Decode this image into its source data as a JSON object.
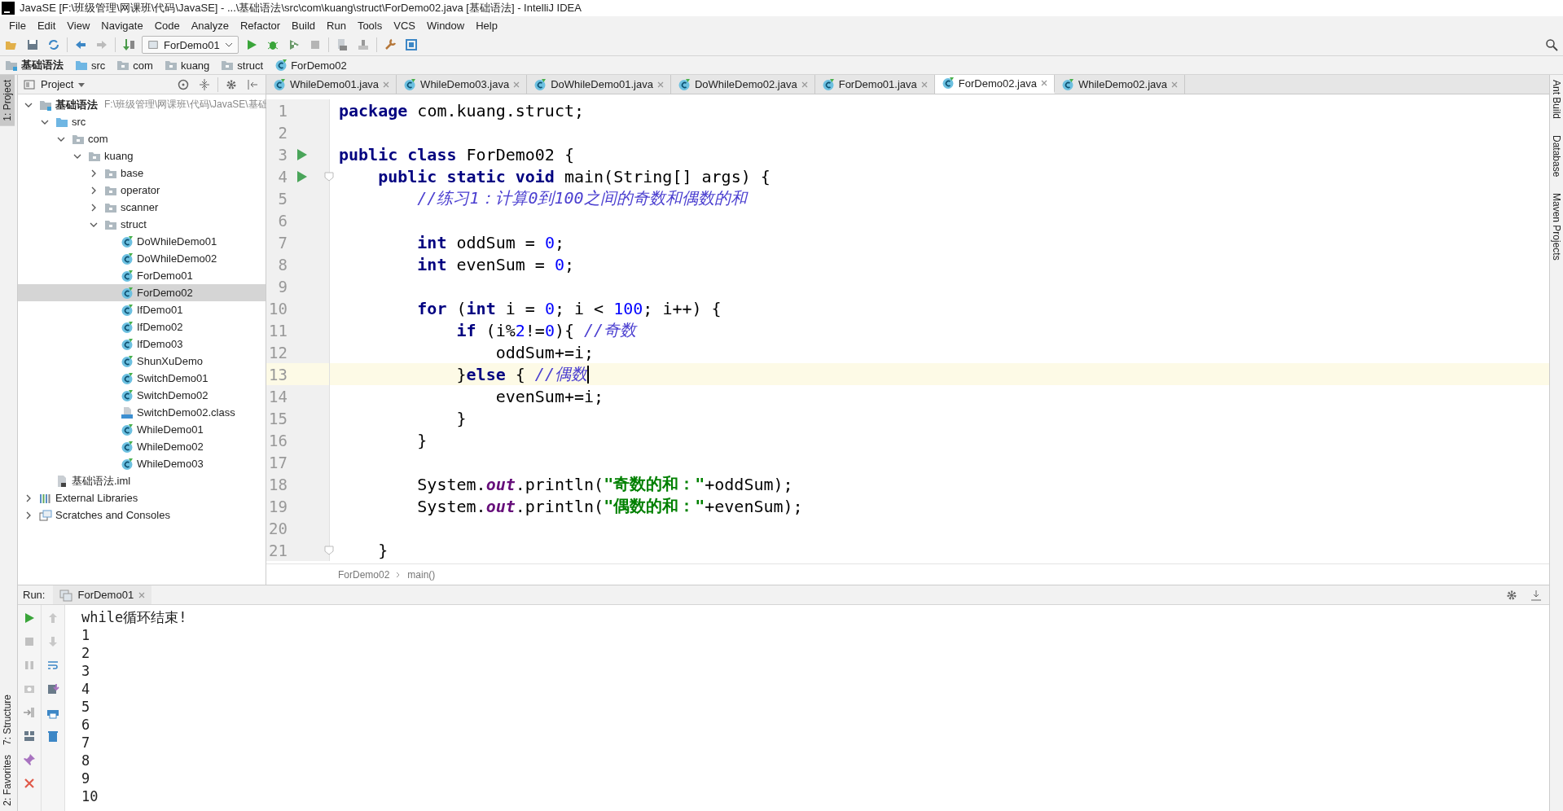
{
  "window": {
    "title": "JavaSE [F:\\班级管理\\网课班\\代码\\JavaSE] - ...\\基础语法\\src\\com\\kuang\\struct\\ForDemo02.java [基础语法] - IntelliJ IDEA"
  },
  "menu": [
    "File",
    "Edit",
    "View",
    "Navigate",
    "Code",
    "Analyze",
    "Refactor",
    "Build",
    "Run",
    "Tools",
    "VCS",
    "Window",
    "Help"
  ],
  "toolbar": {
    "run_config": "ForDemo01"
  },
  "nav_bar": [
    {
      "label": "基础语法",
      "kind": "module"
    },
    {
      "label": "src",
      "kind": "source"
    },
    {
      "label": "com",
      "kind": "package"
    },
    {
      "label": "kuang",
      "kind": "package"
    },
    {
      "label": "struct",
      "kind": "package"
    },
    {
      "label": "ForDemo02",
      "kind": "class"
    }
  ],
  "left_stripe": {
    "top": [
      {
        "label": "1: Project",
        "selected": true
      }
    ],
    "bottom": [
      {
        "label": "7: Structure",
        "selected": false
      },
      {
        "label": "2: Favorites",
        "selected": false
      }
    ]
  },
  "right_stripe": [
    "Ant Build",
    "Database",
    "Maven Projects"
  ],
  "project_panel": {
    "title": "Project",
    "tree": [
      {
        "label": "基础语法",
        "kind": "module",
        "hint": "F:\\班级管理\\网课班\\代码\\JavaSE\\基础",
        "expanded": true,
        "selected": false,
        "children": [
          {
            "label": "src",
            "kind": "source",
            "expanded": true,
            "selected": false,
            "children": [
              {
                "label": "com",
                "kind": "package",
                "expanded": true,
                "selected": false,
                "children": [
                  {
                    "label": "kuang",
                    "kind": "package",
                    "expanded": true,
                    "selected": false,
                    "children": [
                      {
                        "label": "base",
                        "kind": "package",
                        "expanded": false,
                        "selected": false
                      },
                      {
                        "label": "operator",
                        "kind": "package",
                        "expanded": false,
                        "selected": false
                      },
                      {
                        "label": "scanner",
                        "kind": "package",
                        "expanded": false,
                        "selected": false
                      },
                      {
                        "label": "struct",
                        "kind": "package",
                        "expanded": true,
                        "selected": false,
                        "children": [
                          {
                            "label": "DoWhileDemo01",
                            "kind": "class",
                            "selected": false
                          },
                          {
                            "label": "DoWhileDemo02",
                            "kind": "class",
                            "selected": false
                          },
                          {
                            "label": "ForDemo01",
                            "kind": "class",
                            "selected": false
                          },
                          {
                            "label": "ForDemo02",
                            "kind": "class",
                            "selected": true
                          },
                          {
                            "label": "IfDemo01",
                            "kind": "class",
                            "selected": false
                          },
                          {
                            "label": "IfDemo02",
                            "kind": "class",
                            "selected": false
                          },
                          {
                            "label": "IfDemo03",
                            "kind": "class",
                            "selected": false
                          },
                          {
                            "label": "ShunXuDemo",
                            "kind": "class",
                            "selected": false
                          },
                          {
                            "label": "SwitchDemo01",
                            "kind": "class",
                            "selected": false
                          },
                          {
                            "label": "SwitchDemo02",
                            "kind": "class",
                            "selected": false
                          },
                          {
                            "label": "SwitchDemo02.class",
                            "kind": "classfile",
                            "selected": false
                          },
                          {
                            "label": "WhileDemo01",
                            "kind": "class",
                            "selected": false
                          },
                          {
                            "label": "WhileDemo02",
                            "kind": "class",
                            "selected": false
                          },
                          {
                            "label": "WhileDemo03",
                            "kind": "class",
                            "selected": false
                          }
                        ]
                      }
                    ]
                  }
                ]
              }
            ]
          },
          {
            "label": "基础语法.iml",
            "kind": "iml",
            "selected": false
          }
        ]
      },
      {
        "label": "External Libraries",
        "kind": "library",
        "expanded": false,
        "selected": false
      },
      {
        "label": "Scratches and Consoles",
        "kind": "scratches",
        "expanded": false,
        "selected": false
      }
    ]
  },
  "tabs": [
    {
      "label": "WhileDemo01.java",
      "selected": false
    },
    {
      "label": "WhileDemo03.java",
      "selected": false
    },
    {
      "label": "DoWhileDemo01.java",
      "selected": false
    },
    {
      "label": "DoWhileDemo02.java",
      "selected": false
    },
    {
      "label": "ForDemo01.java",
      "selected": false
    },
    {
      "label": "ForDemo02.java",
      "selected": true
    },
    {
      "label": "WhileDemo02.java",
      "selected": false
    }
  ],
  "editor": {
    "lines": [
      {
        "number": "1",
        "current": false,
        "run_marker": false,
        "fold_marker": false,
        "tokens": [
          {
            "kind": "keyword",
            "text": "package"
          },
          {
            "kind": "plain",
            "text": " com.kuang.struct;"
          }
        ]
      },
      {
        "number": "2",
        "current": false,
        "run_marker": false,
        "fold_marker": false
      },
      {
        "number": "3",
        "current": false,
        "run_marker": true,
        "fold_marker": false,
        "tokens": [
          {
            "kind": "keyword",
            "text": "public class"
          },
          {
            "kind": "plain",
            "text": " ForDemo02 {"
          }
        ]
      },
      {
        "number": "4",
        "current": false,
        "run_marker": true,
        "fold_marker": true,
        "tokens": [
          {
            "kind": "keyword",
            "text": "    public static void"
          },
          {
            "kind": "plain",
            "text": " main(String[] args) {"
          }
        ]
      },
      {
        "number": "5",
        "current": false,
        "run_marker": false,
        "fold_marker": false,
        "tokens": [
          {
            "kind": "comment",
            "text": "        //练习1：计算0到100之间的奇数和偶数的和"
          }
        ]
      },
      {
        "number": "6",
        "current": false,
        "run_marker": false,
        "fold_marker": false
      },
      {
        "number": "7",
        "current": false,
        "run_marker": false,
        "fold_marker": false,
        "tokens": [
          {
            "kind": "keyword",
            "text": "        int"
          },
          {
            "kind": "plain",
            "text": " oddSum = "
          },
          {
            "kind": "number",
            "text": "0"
          },
          {
            "kind": "plain",
            "text": ";"
          }
        ]
      },
      {
        "number": "8",
        "current": false,
        "run_marker": false,
        "fold_marker": false,
        "tokens": [
          {
            "kind": "keyword",
            "text": "        int"
          },
          {
            "kind": "plain",
            "text": " evenSum = "
          },
          {
            "kind": "number",
            "text": "0"
          },
          {
            "kind": "plain",
            "text": ";"
          }
        ]
      },
      {
        "number": "9",
        "current": false,
        "run_marker": false,
        "fold_marker": false
      },
      {
        "number": "10",
        "current": false,
        "run_marker": false,
        "fold_marker": false,
        "tokens": [
          {
            "kind": "keyword",
            "text": "        for"
          },
          {
            "kind": "plain",
            "text": " ("
          },
          {
            "kind": "keyword",
            "text": "int"
          },
          {
            "kind": "plain",
            "text": " i = "
          },
          {
            "kind": "number",
            "text": "0"
          },
          {
            "kind": "plain",
            "text": "; i < "
          },
          {
            "kind": "number",
            "text": "100"
          },
          {
            "kind": "plain",
            "text": "; i++) {"
          }
        ]
      },
      {
        "number": "11",
        "current": false,
        "run_marker": false,
        "fold_marker": false,
        "tokens": [
          {
            "kind": "keyword",
            "text": "            if"
          },
          {
            "kind": "plain",
            "text": " (i%"
          },
          {
            "kind": "number",
            "text": "2"
          },
          {
            "kind": "plain",
            "text": "!="
          },
          {
            "kind": "number",
            "text": "0"
          },
          {
            "kind": "plain",
            "text": "){ "
          },
          {
            "kind": "comment",
            "text": "//奇数"
          }
        ]
      },
      {
        "number": "12",
        "current": false,
        "run_marker": false,
        "fold_marker": false,
        "tokens": [
          {
            "kind": "plain",
            "text": "                oddSum+=i;"
          }
        ]
      },
      {
        "number": "13",
        "current": true,
        "run_marker": false,
        "fold_marker": false,
        "tokens": [
          {
            "kind": "plain",
            "text": "            }"
          },
          {
            "kind": "keyword",
            "text": "else"
          },
          {
            "kind": "plain",
            "text": " { "
          },
          {
            "kind": "comment",
            "text": "//偶数"
          }
        ]
      },
      {
        "number": "14",
        "current": false,
        "run_marker": false,
        "fold_marker": false,
        "tokens": [
          {
            "kind": "plain",
            "text": "                evenSum+=i;"
          }
        ]
      },
      {
        "number": "15",
        "current": false,
        "run_marker": false,
        "fold_marker": false,
        "tokens": [
          {
            "kind": "plain",
            "text": "            }"
          }
        ]
      },
      {
        "number": "16",
        "current": false,
        "run_marker": false,
        "fold_marker": false,
        "tokens": [
          {
            "kind": "plain",
            "text": "        }"
          }
        ]
      },
      {
        "number": "17",
        "current": false,
        "run_marker": false,
        "fold_marker": false
      },
      {
        "number": "18",
        "current": false,
        "run_marker": false,
        "fold_marker": false,
        "tokens": [
          {
            "kind": "plain",
            "text": "        System."
          },
          {
            "kind": "field",
            "text": "out"
          },
          {
            "kind": "plain",
            "text": ".println("
          },
          {
            "kind": "string",
            "text": "\"奇数的和：\""
          },
          {
            "kind": "plain",
            "text": "+oddSum);"
          }
        ]
      },
      {
        "number": "19",
        "current": false,
        "run_marker": false,
        "fold_marker": false,
        "tokens": [
          {
            "kind": "plain",
            "text": "        System."
          },
          {
            "kind": "field",
            "text": "out"
          },
          {
            "kind": "plain",
            "text": ".println("
          },
          {
            "kind": "string",
            "text": "\"偶数的和：\""
          },
          {
            "kind": "plain",
            "text": "+evenSum);"
          }
        ]
      },
      {
        "number": "20",
        "current": false,
        "run_marker": false,
        "fold_marker": false
      },
      {
        "number": "21",
        "current": false,
        "run_marker": false,
        "fold_marker": true,
        "tokens": [
          {
            "kind": "plain",
            "text": "    }"
          }
        ]
      }
    ],
    "breadcrumb": [
      "ForDemo02",
      "main()"
    ]
  },
  "run_panel": {
    "label": "Run:",
    "tab": "ForDemo01",
    "output": [
      "while循环结束!",
      "1",
      "2",
      "3",
      "4",
      "5",
      "6",
      "7",
      "8",
      "9",
      "10"
    ]
  }
}
